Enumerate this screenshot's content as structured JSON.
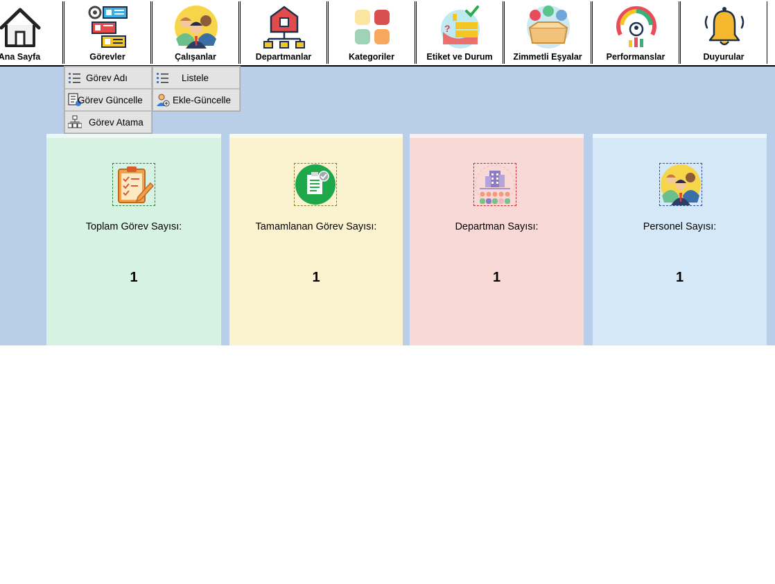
{
  "toolbar": {
    "items": [
      {
        "label": "Ana Sayfa",
        "icon": "home-icon"
      },
      {
        "label": "Görevler",
        "icon": "tasks-icon"
      },
      {
        "label": "Çalışanlar",
        "icon": "employees-icon"
      },
      {
        "label": "Departmanlar",
        "icon": "departments-icon"
      },
      {
        "label": "Kategoriler",
        "icon": "categories-icon"
      },
      {
        "label": "Etiket ve Durum",
        "icon": "tag-status-icon"
      },
      {
        "label": "Zimmetli Eşyalar",
        "icon": "assigned-items-icon"
      },
      {
        "label": "Performanslar",
        "icon": "performance-icon"
      },
      {
        "label": "Duyurular",
        "icon": "announcements-icon"
      }
    ]
  },
  "menu": {
    "primary": [
      "Görev Adı",
      "Görev Güncelle",
      "Görev Atama"
    ],
    "secondary": [
      "Listele",
      "Ekle-Güncelle"
    ]
  },
  "cards": [
    {
      "title": "Toplam Görev Sayısı:",
      "value": "1",
      "color": "#d6f2e2",
      "icon": "clipboard-checklist-icon"
    },
    {
      "title": "Tamamlanan Görev Sayısı:",
      "value": "1",
      "color": "#fbf2cf",
      "icon": "completed-task-icon"
    },
    {
      "title": "Departman Sayısı:",
      "value": "1",
      "color": "#f9d9d6",
      "icon": "department-building-icon"
    },
    {
      "title": "Personel Sayısı:",
      "value": "1",
      "color": "#d5e8f7",
      "icon": "personnel-icon"
    }
  ],
  "colors": {
    "workspace": "#b9cfe9",
    "menu_bg": "#e3e3e3"
  }
}
